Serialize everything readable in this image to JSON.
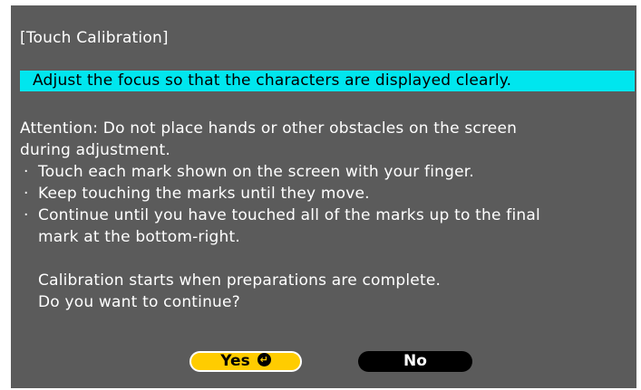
{
  "dialog": {
    "title": "[Touch Calibration]",
    "banner": "Adjust the focus so that the characters are displayed clearly.",
    "attention_line1": "Attention: Do not place hands or other obstacles on the screen",
    "attention_line2": "during adjustment.",
    "bullet_mark": "·",
    "bullets": [
      {
        "line1": "Touch each mark shown on the screen with your finger."
      },
      {
        "line1": "Keep touching the marks until they move."
      },
      {
        "line1": "Continue until you have touched all of the marks up to the final",
        "line2": "mark at the bottom-right."
      }
    ],
    "prompt_line1": "Calibration starts when preparations are complete.",
    "prompt_line2": "Do you want to continue?",
    "yes_label": "Yes",
    "no_label": "No",
    "enter_icon": "enter-key-icon"
  },
  "colors": {
    "background": "#5b5b5b",
    "banner": "#00e6ee",
    "yes_button": "#ffcc00",
    "no_button": "#000000"
  }
}
